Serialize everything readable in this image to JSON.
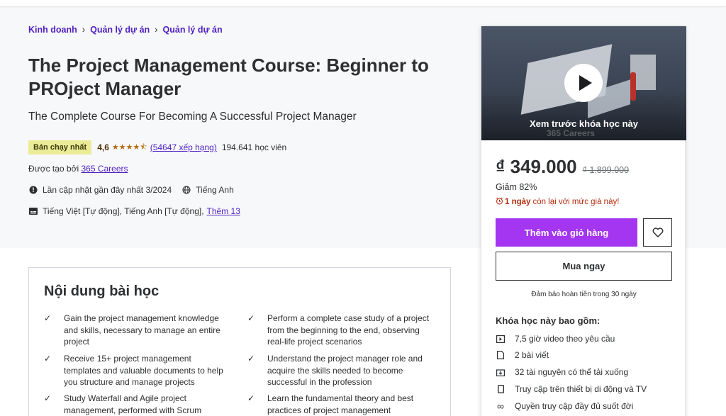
{
  "breadcrumb": [
    "Kinh doanh",
    "Quản lý dự án",
    "Quản lý dự án"
  ],
  "course": {
    "title": "The Project Management Course: Beginner to PROject Manager",
    "subtitle": "The Complete Course For Becoming A Successful Project Manager",
    "badge": "Bán chạy nhất",
    "rating": "4,6",
    "rating_value": 4.6,
    "ratings_count": "(54647 xếp hạng)",
    "students": "194.641 học viên",
    "created_by_label": "Được tạo bởi",
    "creator": "365 Careers",
    "last_updated": "Lần cập nhật gần đây nhất 3/2024",
    "language": "Tiếng Anh",
    "captions": "Tiếng Việt [Tự động], Tiếng Anh [Tự động],",
    "more_captions": "Thêm 13"
  },
  "learn": {
    "title": "Nội dung bài học",
    "items": [
      "Gain the project management knowledge and skills, necessary to manage an entire project",
      "Perform a complete case study of a project from the beginning to the end, observing real-life project scenarios",
      "Receive 15+ project management templates and valuable documents to help you structure and manage projects",
      "Understand the project manager role and acquire the skills needed to become successful in the profession",
      "Study Waterfall and Agile project management, performed with Scrum",
      "Learn the fundamental theory and best practices of project management"
    ]
  },
  "sidebar": {
    "preview_label": "Xem trước khóa học này",
    "watermark": "365 Careers",
    "price": "₫ 349.000",
    "old_price": "₫ 1.899.000",
    "discount": "Giảm 82%",
    "timer_days": "1 ngày",
    "timer_rest": "còn lại với mức giá này!",
    "add_to_cart": "Thêm vào giỏ hàng",
    "buy_now": "Mua ngay",
    "guarantee": "Đảm bảo hoàn tiền trong 30 ngày",
    "includes_title": "Khóa học này bao gồm:",
    "includes": [
      {
        "icon": "video-icon",
        "label": "7,5 giờ video theo yêu cầu"
      },
      {
        "icon": "article-icon",
        "label": "2 bài viết"
      },
      {
        "icon": "download-icon",
        "label": "32 tài nguyên có thể tải xuống"
      },
      {
        "icon": "mobile-icon",
        "label": "Truy cập trên thiết bị di động và TV"
      },
      {
        "icon": "infinity-icon",
        "label": "Quyền truy cập đầy đủ suốt đời"
      }
    ]
  },
  "colors": {
    "accent": "#a435f0",
    "link": "#5022c3",
    "badge_bg": "#eceb98",
    "star": "#b4690e",
    "timer": "#b32d0f"
  }
}
